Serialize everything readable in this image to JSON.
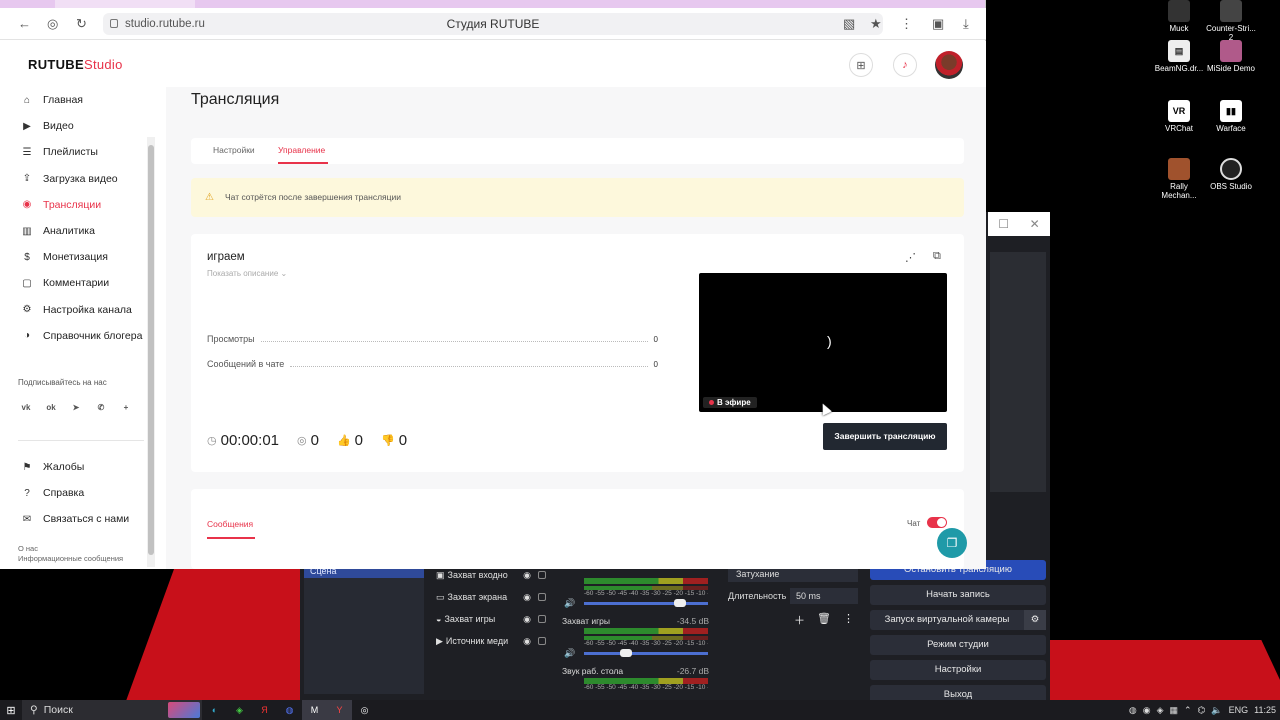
{
  "browser": {
    "url": "studio.rutube.ru",
    "page_title": "Студия RUTUBE"
  },
  "header": {
    "logo_main": "RUTUBE",
    "logo_sub": "Studio"
  },
  "sidebar": {
    "items": [
      {
        "label": "Главная",
        "icon": "home-icon"
      },
      {
        "label": "Видео",
        "icon": "video-icon"
      },
      {
        "label": "Плейлисты",
        "icon": "playlist-icon"
      },
      {
        "label": "Загрузка видео",
        "icon": "upload-icon"
      },
      {
        "label": "Трансляции",
        "icon": "broadcast-icon",
        "active": true
      },
      {
        "label": "Аналитика",
        "icon": "analytics-icon"
      },
      {
        "label": "Монетизация",
        "icon": "monetization-icon"
      },
      {
        "label": "Комментарии",
        "icon": "comments-icon"
      },
      {
        "label": "Настройка канала",
        "icon": "settings-icon"
      },
      {
        "label": "Справочник блогера",
        "icon": "guide-icon"
      }
    ],
    "follow_label": "Подписывайтесь на нас",
    "bottom_items": [
      {
        "label": "Жалобы",
        "icon": "flag-icon"
      },
      {
        "label": "Справка",
        "icon": "help-icon"
      },
      {
        "label": "Связаться с нами",
        "icon": "mail-icon"
      }
    ],
    "about": "О нас",
    "info": "Информационные сообщения"
  },
  "main": {
    "title": "Трансляция",
    "tabs": [
      {
        "label": "Настройки"
      },
      {
        "label": "Управление",
        "active": true
      }
    ],
    "warning": "Чат сотрётся после завершения трансляции",
    "stream": {
      "title": "играем",
      "show_description": "Показать описание",
      "stats": [
        {
          "label": "Просмотры",
          "value": "0"
        },
        {
          "label": "Сообщений в чате",
          "value": "0"
        }
      ],
      "live_badge": "В эфире",
      "timer": "00:00:01",
      "viewers": "0",
      "likes": "0",
      "dislikes": "0",
      "end_button": "Завершить трансляцию"
    },
    "chat": {
      "tab": "Сообщения",
      "toggle_label": "Чат",
      "enabled": true
    }
  },
  "obs": {
    "scene": "Сцена",
    "sources": [
      "Захват входно",
      "Захват экрана",
      "Захват игры",
      "Источник меди"
    ],
    "mixer": [
      {
        "name": "",
        "db": ""
      },
      {
        "name": "Захват игры",
        "db": "-34.5 dB"
      },
      {
        "name": "Звук раб. стола",
        "db": "-26.7 dB"
      }
    ],
    "meter_scale": "-60 -55 -50 -45 -40 -35 -30 -25 -20 -15 -10 -5 0",
    "transition": "Затухание",
    "duration_label": "Длительность",
    "duration_value": "50 ms",
    "controls": [
      "Остановить трансляцию",
      "Начать запись",
      "Запуск виртуальной камеры",
      "Режим студии",
      "Настройки",
      "Выход"
    ]
  },
  "desktop_icons": [
    {
      "label": "Muck"
    },
    {
      "label": "Counter-Stri... 2"
    },
    {
      "label": "BeamNG.dr..."
    },
    {
      "label": "MiSide Demo"
    },
    {
      "label": "VRChat"
    },
    {
      "label": "Warface"
    },
    {
      "label": "Rally Mechan..."
    },
    {
      "label": "OBS Studio"
    }
  ],
  "taskbar": {
    "search": "Поиск",
    "lang": "ENG",
    "time": "11:25"
  }
}
